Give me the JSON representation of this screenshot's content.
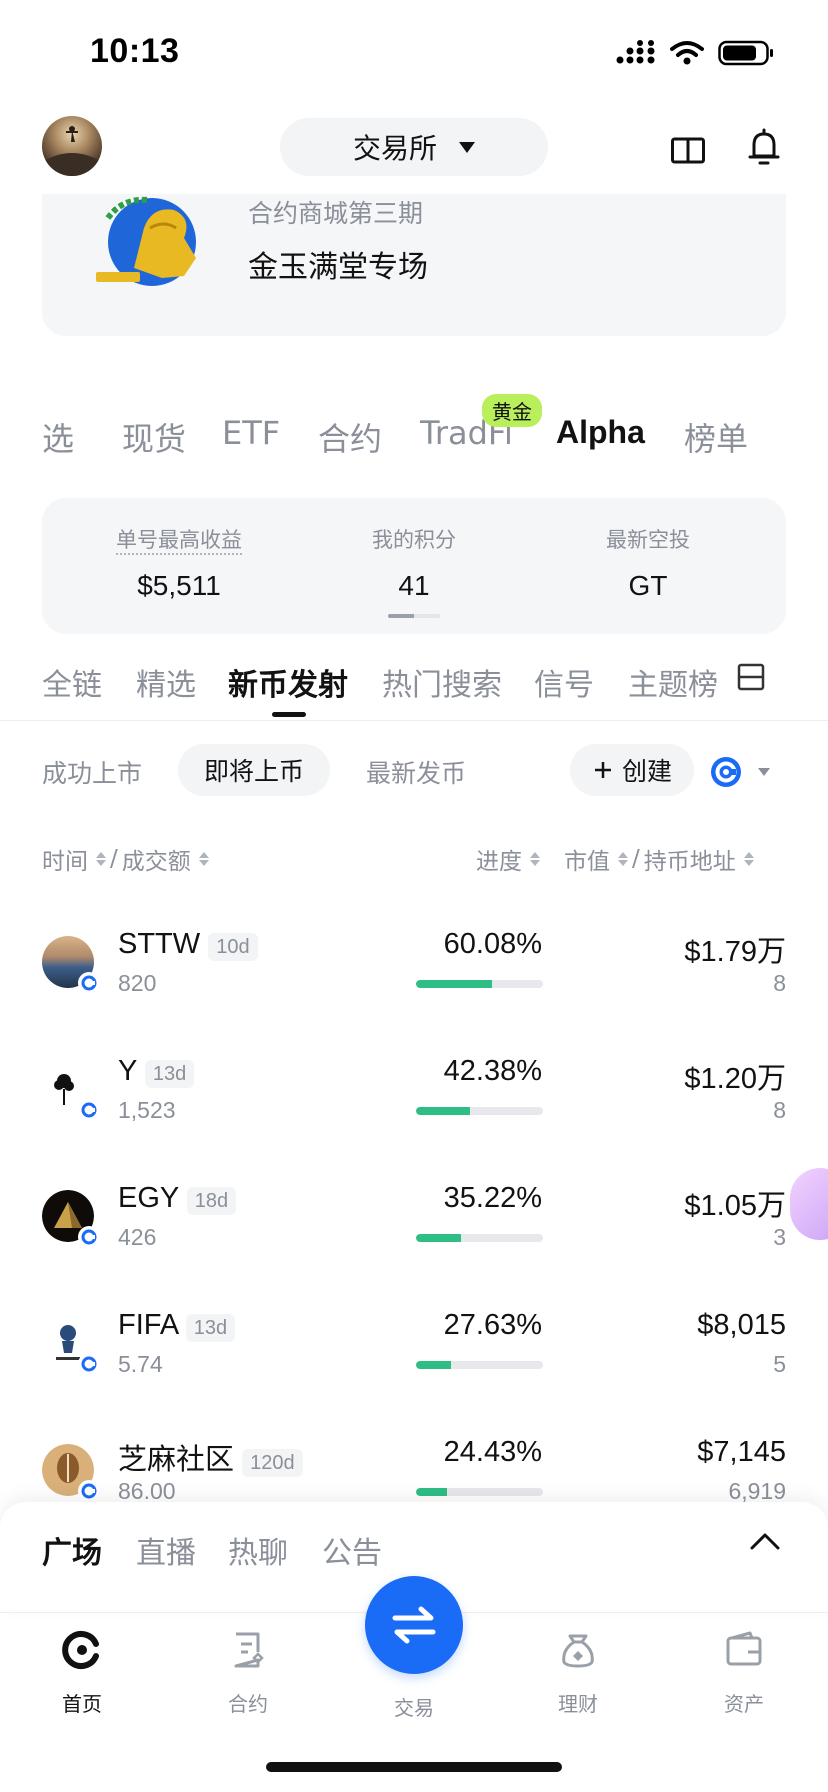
{
  "status_bar": {
    "time": "10:13"
  },
  "header": {
    "exchange_label": "交易所"
  },
  "banner": {
    "subtitle": "合约商城第三期",
    "title": "金玉满堂专场"
  },
  "category_tabs": [
    {
      "label": "自选",
      "visible_text": "选"
    },
    {
      "label": "现货"
    },
    {
      "label": "ETF"
    },
    {
      "label": "合约"
    },
    {
      "label": "TradFi",
      "badge": "黄金"
    },
    {
      "label": "Alpha",
      "active": true
    },
    {
      "label": "榜单"
    }
  ],
  "stats": [
    {
      "label": "单号最高收益",
      "value": "$5,511"
    },
    {
      "label": "我的积分",
      "value": "41"
    },
    {
      "label": "最新空投",
      "value": "GT"
    }
  ],
  "sub_tabs": [
    {
      "label": "全链"
    },
    {
      "label": "精选"
    },
    {
      "label": "新币发射",
      "active": true
    },
    {
      "label": "热门搜索"
    },
    {
      "label": "信号"
    },
    {
      "label": "主题榜"
    }
  ],
  "filters": {
    "listed": "成功上市",
    "upcoming": "即将上币",
    "latest": "最新发币",
    "create": "创建"
  },
  "columns": {
    "time": "时间",
    "slash": "/",
    "volume": "成交额",
    "progress": "进度",
    "mcap": "市值",
    "holders": "持币地址"
  },
  "tokens": [
    {
      "symbol": "STTW",
      "age": "10d",
      "volume": "820",
      "progress_text": "60.08%",
      "progress": 60.08,
      "mcap": "$1.79万",
      "holders": "8"
    },
    {
      "symbol": "Y",
      "age": "13d",
      "volume": "1,523",
      "progress_text": "42.38%",
      "progress": 42.38,
      "mcap": "$1.20万",
      "holders": "8"
    },
    {
      "symbol": "EGY",
      "age": "18d",
      "volume": "426",
      "progress_text": "35.22%",
      "progress": 35.22,
      "mcap": "$1.05万",
      "holders": "3"
    },
    {
      "symbol": "FIFA",
      "age": "13d",
      "volume": "5.74",
      "progress_text": "27.63%",
      "progress": 27.63,
      "mcap": "$8,015",
      "holders": "5"
    },
    {
      "symbol": "芝麻社区",
      "age": "120d",
      "volume": "86.00",
      "progress_text": "24.43%",
      "progress": 24.43,
      "mcap": "$7,145",
      "holders": "6,919"
    }
  ],
  "sheet_tabs": [
    {
      "label": "广场",
      "active": true
    },
    {
      "label": "直播"
    },
    {
      "label": "热聊"
    },
    {
      "label": "公告"
    }
  ],
  "bottom_nav": [
    {
      "label": "首页",
      "icon": "home-icon",
      "active": true
    },
    {
      "label": "合约",
      "icon": "contract-icon"
    },
    {
      "label": "交易",
      "icon": "swap-icon"
    },
    {
      "label": "理财",
      "icon": "wealth-icon"
    },
    {
      "label": "资产",
      "icon": "wallet-icon"
    }
  ],
  "colors": {
    "accent": "#1a6bf5",
    "progress": "#2ebd85",
    "gold_badge": "#b9ef5a",
    "muted": "#8a8f99"
  }
}
